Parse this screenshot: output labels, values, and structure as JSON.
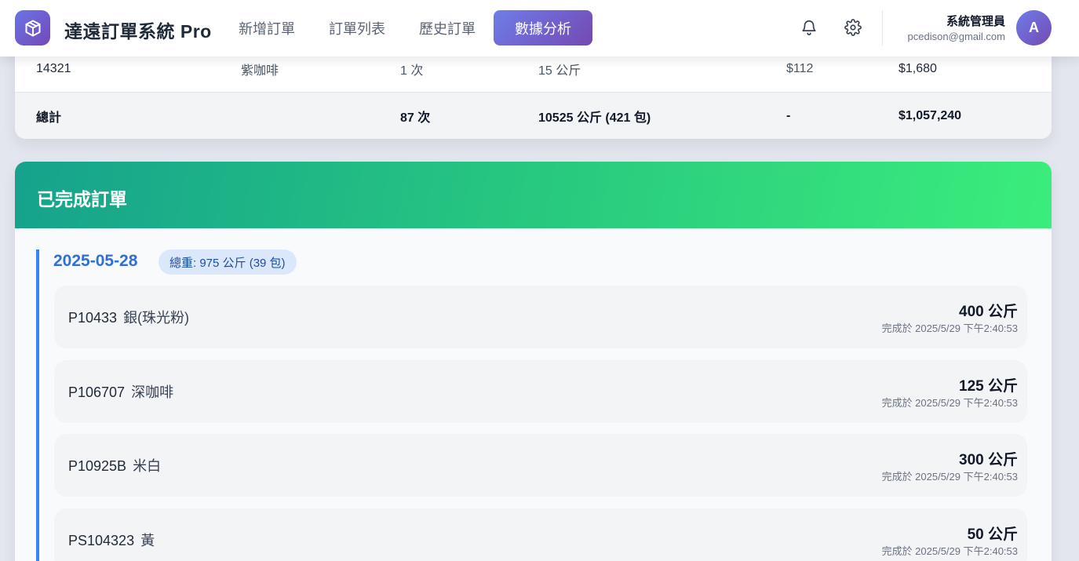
{
  "app": {
    "title": "達遠訂單系統 Pro",
    "logo_icon": "cube-icon",
    "accent_gradient": [
      "#6f7de8",
      "#7449b3"
    ]
  },
  "nav": {
    "items": [
      {
        "label": "新增訂單",
        "active": false
      },
      {
        "label": "訂單列表",
        "active": false
      },
      {
        "label": "歷史訂單",
        "active": false
      },
      {
        "label": "數據分析",
        "active": true
      }
    ]
  },
  "header_actions": {
    "notification_icon": "bell-icon",
    "settings_icon": "gear-icon"
  },
  "user": {
    "name": "系統管理員",
    "email": "pcedison@gmail.com",
    "avatar_initial": "A"
  },
  "summary_table": {
    "rows": [
      {
        "code": "14321",
        "color": "紫咖啡",
        "times": "1 次",
        "weight": "15 公斤",
        "price": "$112",
        "total": "$1,680"
      }
    ],
    "total_row": {
      "label": "總計",
      "color": "",
      "times": "87 次",
      "weight": "10525 公斤 (421 包)",
      "price": "-",
      "total": "$1,057,240"
    }
  },
  "completed_orders": {
    "title": "已完成訂單",
    "header_gradient": [
      "#16a28d",
      "#3bed7c"
    ],
    "groups": [
      {
        "date": "2025-05-28",
        "weight_badge": "總重: 975 公斤 (39 包)",
        "orders": [
          {
            "code": "P10433",
            "color": "銀(珠光粉)",
            "weight": "400 公斤",
            "completed": "完成於 2025/5/29 下午2:40:53"
          },
          {
            "code": "P106707",
            "color": "深咖啡",
            "weight": "125 公斤",
            "completed": "完成於 2025/5/29 下午2:40:53"
          },
          {
            "code": "P10925B",
            "color": "米白",
            "weight": "300 公斤",
            "completed": "完成於 2025/5/29 下午2:40:53"
          },
          {
            "code": "PS104323",
            "color": "黃",
            "weight": "50 公斤",
            "completed": "完成於 2025/5/29 下午2:40:53"
          }
        ]
      }
    ]
  }
}
